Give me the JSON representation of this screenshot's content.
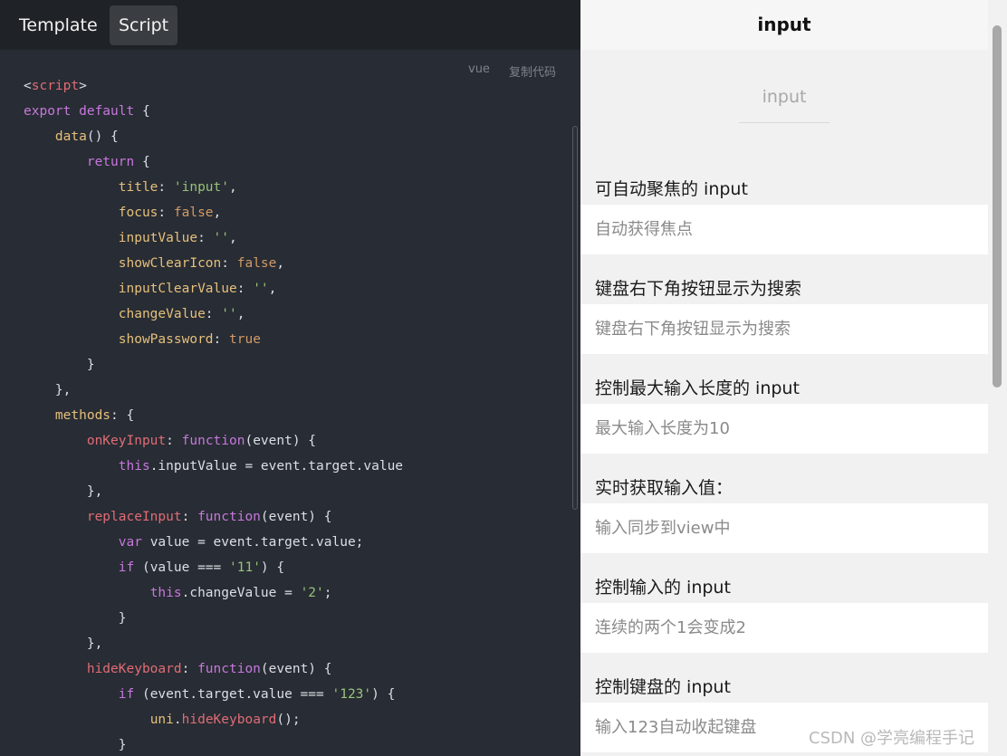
{
  "tabs": {
    "template": "Template",
    "script": "Script"
  },
  "code": {
    "lang": "vue",
    "copy_label": "复制代码",
    "lines": [
      [
        [
          "c-p",
          "<"
        ],
        [
          "c-tag",
          "script"
        ],
        [
          "c-p",
          ">"
        ]
      ],
      [
        [
          "c-kw",
          "export default"
        ],
        [
          "c-p",
          " {"
        ]
      ],
      [
        [
          "c-p",
          "    "
        ],
        [
          "c-fn",
          "data"
        ],
        [
          "c-p",
          "() {"
        ]
      ],
      [
        [
          "c-p",
          "        "
        ],
        [
          "c-kw",
          "return"
        ],
        [
          "c-p",
          " {"
        ]
      ],
      [
        [
          "c-p",
          "            "
        ],
        [
          "c-fn",
          "title"
        ],
        [
          "c-p",
          ": "
        ],
        [
          "c-str",
          "'input'"
        ],
        [
          "c-p",
          ","
        ]
      ],
      [
        [
          "c-p",
          "            "
        ],
        [
          "c-fn",
          "focus"
        ],
        [
          "c-p",
          ": "
        ],
        [
          "c-bool",
          "false"
        ],
        [
          "c-p",
          ","
        ]
      ],
      [
        [
          "c-p",
          "            "
        ],
        [
          "c-fn",
          "inputValue"
        ],
        [
          "c-p",
          ": "
        ],
        [
          "c-str",
          "''"
        ],
        [
          "c-p",
          ","
        ]
      ],
      [
        [
          "c-p",
          "            "
        ],
        [
          "c-fn",
          "showClearIcon"
        ],
        [
          "c-p",
          ": "
        ],
        [
          "c-bool",
          "false"
        ],
        [
          "c-p",
          ","
        ]
      ],
      [
        [
          "c-p",
          "            "
        ],
        [
          "c-fn",
          "inputClearValue"
        ],
        [
          "c-p",
          ": "
        ],
        [
          "c-str",
          "''"
        ],
        [
          "c-p",
          ","
        ]
      ],
      [
        [
          "c-p",
          "            "
        ],
        [
          "c-fn",
          "changeValue"
        ],
        [
          "c-p",
          ": "
        ],
        [
          "c-str",
          "''"
        ],
        [
          "c-p",
          ","
        ]
      ],
      [
        [
          "c-p",
          "            "
        ],
        [
          "c-fn",
          "showPassword"
        ],
        [
          "c-p",
          ": "
        ],
        [
          "c-bool",
          "true"
        ]
      ],
      [
        [
          "c-p",
          "        }"
        ]
      ],
      [
        [
          "c-p",
          "    },"
        ]
      ],
      [
        [
          "c-p",
          "    "
        ],
        [
          "c-fn",
          "methods"
        ],
        [
          "c-p",
          ": {"
        ]
      ],
      [
        [
          "c-p",
          "        "
        ],
        [
          "c-tag",
          "onKeyInput"
        ],
        [
          "c-p",
          ": "
        ],
        [
          "c-kw",
          "function"
        ],
        [
          "c-p",
          "(event) {"
        ]
      ],
      [
        [
          "c-p",
          "            "
        ],
        [
          "c-kw",
          "this"
        ],
        [
          "c-p",
          ".inputValue = event.target.value"
        ]
      ],
      [
        [
          "c-p",
          "        },"
        ]
      ],
      [
        [
          "c-p",
          "        "
        ],
        [
          "c-tag",
          "replaceInput"
        ],
        [
          "c-p",
          ": "
        ],
        [
          "c-kw",
          "function"
        ],
        [
          "c-p",
          "(event) {"
        ]
      ],
      [
        [
          "c-p",
          "            "
        ],
        [
          "c-kw",
          "var"
        ],
        [
          "c-p",
          " value = event.target.value;"
        ]
      ],
      [
        [
          "c-p",
          "            "
        ],
        [
          "c-kw",
          "if"
        ],
        [
          "c-p",
          " (value === "
        ],
        [
          "c-str",
          "'11'"
        ],
        [
          "c-p",
          ") {"
        ]
      ],
      [
        [
          "c-p",
          "                "
        ],
        [
          "c-kw",
          "this"
        ],
        [
          "c-p",
          ".changeValue = "
        ],
        [
          "c-str",
          "'2'"
        ],
        [
          "c-p",
          ";"
        ]
      ],
      [
        [
          "c-p",
          "            }"
        ]
      ],
      [
        [
          "c-p",
          "        },"
        ]
      ],
      [
        [
          "c-p",
          "        "
        ],
        [
          "c-tag",
          "hideKeyboard"
        ],
        [
          "c-p",
          ": "
        ],
        [
          "c-kw",
          "function"
        ],
        [
          "c-p",
          "(event) {"
        ]
      ],
      [
        [
          "c-p",
          "            "
        ],
        [
          "c-kw",
          "if"
        ],
        [
          "c-p",
          " (event.target.value === "
        ],
        [
          "c-str",
          "'123'"
        ],
        [
          "c-p",
          ") {"
        ]
      ],
      [
        [
          "c-p",
          "                "
        ],
        [
          "c-fn",
          "uni"
        ],
        [
          "c-p",
          "."
        ],
        [
          "c-tag",
          "hideKeyboard"
        ],
        [
          "c-p",
          "();"
        ]
      ],
      [
        [
          "c-p",
          "            }"
        ]
      ]
    ]
  },
  "preview": {
    "nav_title": "input",
    "demo_placeholder": "input",
    "sections": [
      {
        "title": "可自动聚焦的 input",
        "placeholder": "自动获得焦点"
      },
      {
        "title": "键盘右下角按钮显示为搜索",
        "placeholder": "键盘右下角按钮显示为搜索"
      },
      {
        "title": "控制最大输入长度的 input",
        "placeholder": "最大输入长度为10"
      },
      {
        "title": "实时获取输入值：",
        "placeholder": "输入同步到view中"
      },
      {
        "title": "控制输入的 input",
        "placeholder": "连续的两个1会变成2"
      },
      {
        "title": "控制键盘的 input",
        "placeholder": "输入123自动收起键盘"
      }
    ]
  },
  "watermark": "CSDN @学亮编程手记"
}
